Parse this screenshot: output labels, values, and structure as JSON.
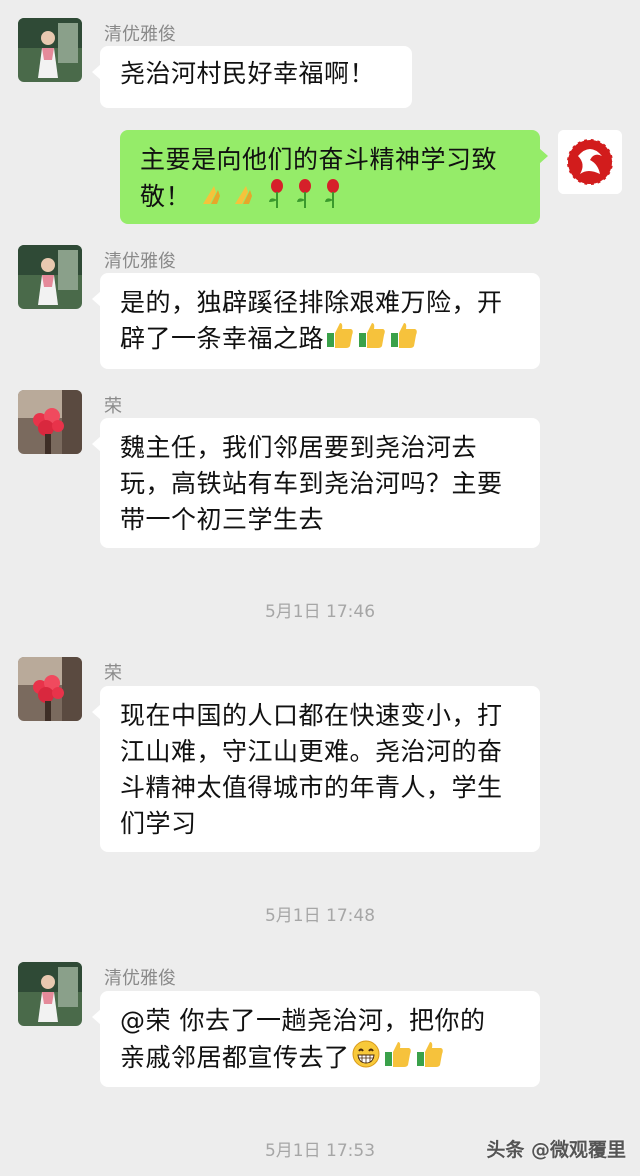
{
  "messages": [
    {
      "sender": "清优雅俊",
      "text": "尧治河村民好幸福啊！"
    },
    {
      "sender": "",
      "text": "主要是向他们的奋斗精神学习致",
      "text2": "敬！"
    },
    {
      "sender": "清优雅俊",
      "text": "是的，独辟蹊径排除艰难万险，开",
      "text2": "辟了一条幸福之路"
    },
    {
      "sender": "荣",
      "text": "魏主任，我们邻居要到尧治河去",
      "text2": "玩，高铁站有车到尧治河吗？主要",
      "text3": "带一个初三学生去"
    },
    {
      "sender": "荣",
      "text": "现在中国的人口都在快速变小，打",
      "text2": "江山难，守江山更难。尧治河的奋",
      "text3": "斗精神太值得城市的年青人，学生",
      "text4": "们学习"
    },
    {
      "sender": "清优雅俊",
      "text": "@荣  你去了一趟尧治河，把你的",
      "text2": "亲戚邻居都宣传去了"
    }
  ],
  "timestamps": [
    "5月1日 17:46",
    "5月1日 17:48",
    "5月1日 17:53"
  ],
  "watermark": "头条 @微观覆里",
  "colors": {
    "background": "#ededed",
    "bubble_other": "#ffffff",
    "bubble_mine": "#95ec69"
  }
}
